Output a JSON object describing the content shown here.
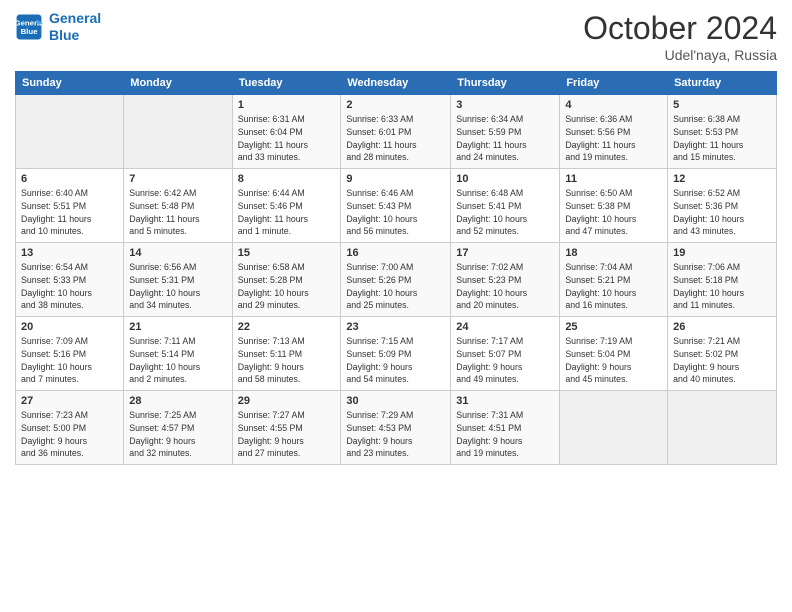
{
  "header": {
    "logo_line1": "General",
    "logo_line2": "Blue",
    "month_year": "October 2024",
    "location": "Udel'naya, Russia"
  },
  "weekdays": [
    "Sunday",
    "Monday",
    "Tuesday",
    "Wednesday",
    "Thursday",
    "Friday",
    "Saturday"
  ],
  "weeks": [
    [
      {
        "day": "",
        "info": ""
      },
      {
        "day": "",
        "info": ""
      },
      {
        "day": "1",
        "info": "Sunrise: 6:31 AM\nSunset: 6:04 PM\nDaylight: 11 hours\nand 33 minutes."
      },
      {
        "day": "2",
        "info": "Sunrise: 6:33 AM\nSunset: 6:01 PM\nDaylight: 11 hours\nand 28 minutes."
      },
      {
        "day": "3",
        "info": "Sunrise: 6:34 AM\nSunset: 5:59 PM\nDaylight: 11 hours\nand 24 minutes."
      },
      {
        "day": "4",
        "info": "Sunrise: 6:36 AM\nSunset: 5:56 PM\nDaylight: 11 hours\nand 19 minutes."
      },
      {
        "day": "5",
        "info": "Sunrise: 6:38 AM\nSunset: 5:53 PM\nDaylight: 11 hours\nand 15 minutes."
      }
    ],
    [
      {
        "day": "6",
        "info": "Sunrise: 6:40 AM\nSunset: 5:51 PM\nDaylight: 11 hours\nand 10 minutes."
      },
      {
        "day": "7",
        "info": "Sunrise: 6:42 AM\nSunset: 5:48 PM\nDaylight: 11 hours\nand 5 minutes."
      },
      {
        "day": "8",
        "info": "Sunrise: 6:44 AM\nSunset: 5:46 PM\nDaylight: 11 hours\nand 1 minute."
      },
      {
        "day": "9",
        "info": "Sunrise: 6:46 AM\nSunset: 5:43 PM\nDaylight: 10 hours\nand 56 minutes."
      },
      {
        "day": "10",
        "info": "Sunrise: 6:48 AM\nSunset: 5:41 PM\nDaylight: 10 hours\nand 52 minutes."
      },
      {
        "day": "11",
        "info": "Sunrise: 6:50 AM\nSunset: 5:38 PM\nDaylight: 10 hours\nand 47 minutes."
      },
      {
        "day": "12",
        "info": "Sunrise: 6:52 AM\nSunset: 5:36 PM\nDaylight: 10 hours\nand 43 minutes."
      }
    ],
    [
      {
        "day": "13",
        "info": "Sunrise: 6:54 AM\nSunset: 5:33 PM\nDaylight: 10 hours\nand 38 minutes."
      },
      {
        "day": "14",
        "info": "Sunrise: 6:56 AM\nSunset: 5:31 PM\nDaylight: 10 hours\nand 34 minutes."
      },
      {
        "day": "15",
        "info": "Sunrise: 6:58 AM\nSunset: 5:28 PM\nDaylight: 10 hours\nand 29 minutes."
      },
      {
        "day": "16",
        "info": "Sunrise: 7:00 AM\nSunset: 5:26 PM\nDaylight: 10 hours\nand 25 minutes."
      },
      {
        "day": "17",
        "info": "Sunrise: 7:02 AM\nSunset: 5:23 PM\nDaylight: 10 hours\nand 20 minutes."
      },
      {
        "day": "18",
        "info": "Sunrise: 7:04 AM\nSunset: 5:21 PM\nDaylight: 10 hours\nand 16 minutes."
      },
      {
        "day": "19",
        "info": "Sunrise: 7:06 AM\nSunset: 5:18 PM\nDaylight: 10 hours\nand 11 minutes."
      }
    ],
    [
      {
        "day": "20",
        "info": "Sunrise: 7:09 AM\nSunset: 5:16 PM\nDaylight: 10 hours\nand 7 minutes."
      },
      {
        "day": "21",
        "info": "Sunrise: 7:11 AM\nSunset: 5:14 PM\nDaylight: 10 hours\nand 2 minutes."
      },
      {
        "day": "22",
        "info": "Sunrise: 7:13 AM\nSunset: 5:11 PM\nDaylight: 9 hours\nand 58 minutes."
      },
      {
        "day": "23",
        "info": "Sunrise: 7:15 AM\nSunset: 5:09 PM\nDaylight: 9 hours\nand 54 minutes."
      },
      {
        "day": "24",
        "info": "Sunrise: 7:17 AM\nSunset: 5:07 PM\nDaylight: 9 hours\nand 49 minutes."
      },
      {
        "day": "25",
        "info": "Sunrise: 7:19 AM\nSunset: 5:04 PM\nDaylight: 9 hours\nand 45 minutes."
      },
      {
        "day": "26",
        "info": "Sunrise: 7:21 AM\nSunset: 5:02 PM\nDaylight: 9 hours\nand 40 minutes."
      }
    ],
    [
      {
        "day": "27",
        "info": "Sunrise: 7:23 AM\nSunset: 5:00 PM\nDaylight: 9 hours\nand 36 minutes."
      },
      {
        "day": "28",
        "info": "Sunrise: 7:25 AM\nSunset: 4:57 PM\nDaylight: 9 hours\nand 32 minutes."
      },
      {
        "day": "29",
        "info": "Sunrise: 7:27 AM\nSunset: 4:55 PM\nDaylight: 9 hours\nand 27 minutes."
      },
      {
        "day": "30",
        "info": "Sunrise: 7:29 AM\nSunset: 4:53 PM\nDaylight: 9 hours\nand 23 minutes."
      },
      {
        "day": "31",
        "info": "Sunrise: 7:31 AM\nSunset: 4:51 PM\nDaylight: 9 hours\nand 19 minutes."
      },
      {
        "day": "",
        "info": ""
      },
      {
        "day": "",
        "info": ""
      }
    ]
  ]
}
